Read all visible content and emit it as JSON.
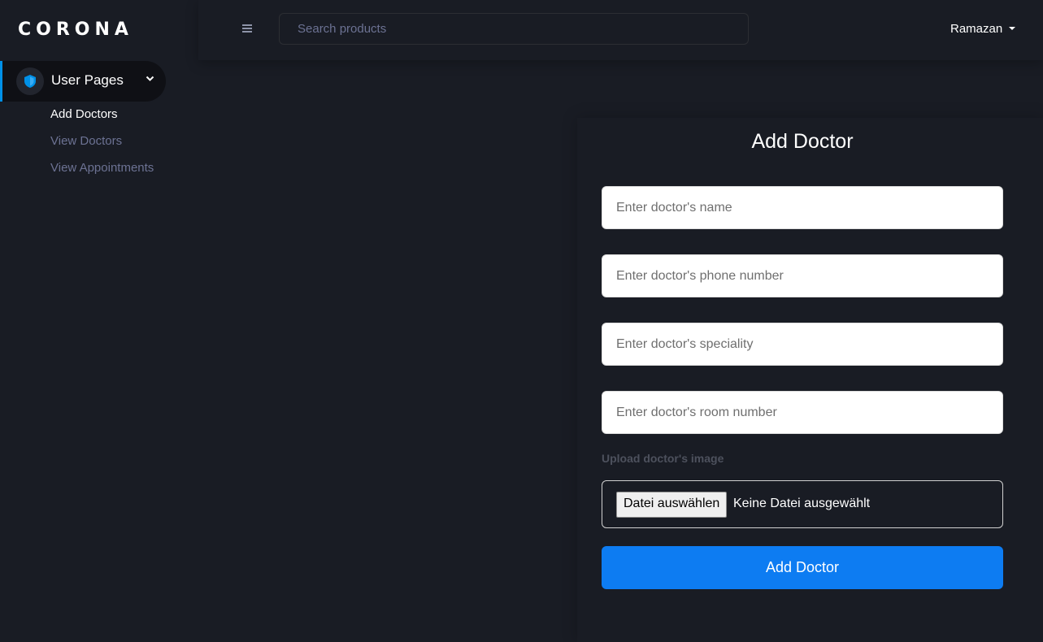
{
  "brand": "CORONA",
  "sidebar": {
    "section_label": "User Pages",
    "items": [
      {
        "label": "Add Doctors",
        "active": true
      },
      {
        "label": "View Doctors",
        "active": false
      },
      {
        "label": "View Appointments",
        "active": false
      }
    ],
    "section_icon": "shield-icon",
    "accent_color": "#0090e7"
  },
  "topbar": {
    "search_placeholder": "Search products",
    "user_name": "Ramazan"
  },
  "form": {
    "title": "Add Doctor",
    "fields": [
      {
        "placeholder": "Enter doctor's name",
        "value": ""
      },
      {
        "placeholder": "Enter doctor's phone number",
        "value": ""
      },
      {
        "placeholder": "Enter doctor's speciality",
        "value": ""
      },
      {
        "placeholder": "Enter doctor's room number",
        "value": ""
      }
    ],
    "upload_label": "Upload doctor's image",
    "file_button_label": "Datei auswählen",
    "file_status": "Keine Datei ausgewählt",
    "submit_label": "Add Doctor",
    "submit_color": "#0d7cf2"
  }
}
